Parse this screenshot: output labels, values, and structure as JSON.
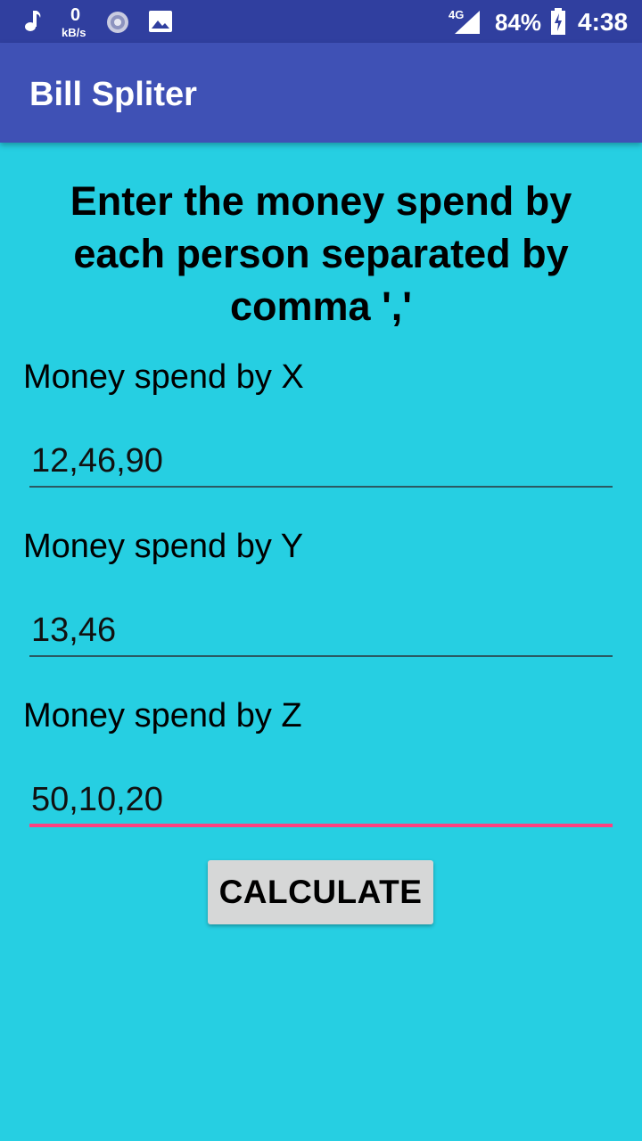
{
  "status_bar": {
    "net_speed_value": "0",
    "net_speed_unit": "kB/s",
    "network_type": "4G",
    "battery": "84%",
    "time": "4:38",
    "icons": [
      "music-note-icon",
      "sync-icon",
      "image-icon",
      "signal-icon",
      "battery-charging-icon"
    ]
  },
  "app_bar": {
    "title": "Bill Spliter"
  },
  "main": {
    "instruction": "Enter the money spend by each person separated by comma ','",
    "fields": [
      {
        "label": "Money spend by X",
        "value": "12,46,90"
      },
      {
        "label": "Money spend by Y",
        "value": "13,46"
      },
      {
        "label": "Money spend by Z",
        "value": "50,10,20"
      }
    ],
    "calculate_label": "CALCULATE"
  },
  "colors": {
    "background": "#26cfe2",
    "app_bar": "#3f51b5",
    "status_bar": "#303f9f",
    "accent": "#ff4081"
  }
}
